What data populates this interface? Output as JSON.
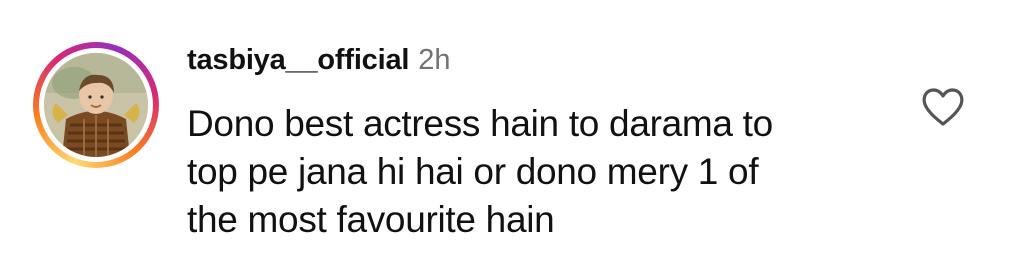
{
  "comment": {
    "username": "tasbiya__official",
    "timestamp": "2h",
    "text_lines": [
      "Dono best actress hain to darama to",
      "top pe jana hi hai or dono mery 1 of",
      "the most favourite hain"
    ],
    "like_icon": "heart-outline-icon",
    "avatar_ring_colors": [
      "#feda75",
      "#fa7e1e",
      "#d62976",
      "#962fbf"
    ]
  }
}
